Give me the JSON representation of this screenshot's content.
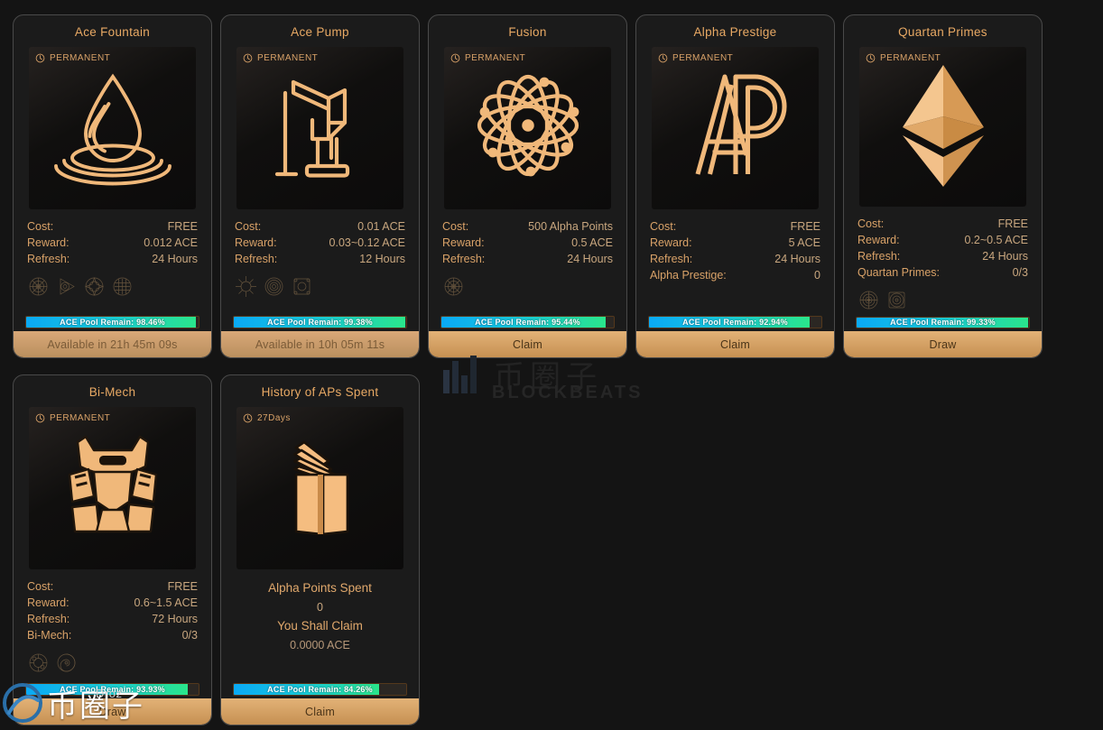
{
  "theme": {
    "page_bg": "#141414",
    "card_bg": "#1b1b1b",
    "card_border": "#4a4a4a",
    "accent": "#e8a964",
    "value_text": "#c9a77f",
    "button_gold": "#e3b277",
    "bar_start": "#0aa9f5",
    "bar_end": "#2ae68b"
  },
  "labels": {
    "cost": "Cost:",
    "reward": "Reward:",
    "refresh": "Refresh:",
    "pool_prefix": "ACE Pool Remain:"
  },
  "cards": [
    {
      "title": "Ace Fountain",
      "badge": "PERMANENT",
      "badge_icon": "clock-icon",
      "art_icon": "water-drop-ripple-icon",
      "stats": [
        {
          "label": "Cost:",
          "value": "FREE"
        },
        {
          "label": "Reward:",
          "value": "0.012 ACE"
        },
        {
          "label": "Refresh:",
          "value": "24 Hours"
        }
      ],
      "emblems": [
        "emblem-gear-icon",
        "emblem-triangle-icon",
        "emblem-star-icon",
        "emblem-grid-icon"
      ],
      "pool_percent": 98.46,
      "pool_text": "ACE Pool Remain: 98.46%",
      "action_label": "Available in 21h 45m 09s",
      "action_state": "waiting"
    },
    {
      "title": "Ace Pump",
      "badge": "PERMANENT",
      "badge_icon": "clock-icon",
      "art_icon": "hand-water-pump-icon",
      "stats": [
        {
          "label": "Cost:",
          "value": "0.01 ACE"
        },
        {
          "label": "Reward:",
          "value": "0.03~0.12 ACE"
        },
        {
          "label": "Refresh:",
          "value": "12 Hours"
        }
      ],
      "emblems": [
        "emblem-burst-icon",
        "emblem-spiral-icon",
        "emblem-square-icon"
      ],
      "pool_percent": 99.38,
      "pool_text": "ACE Pool Remain: 99.38%",
      "action_label": "Available in 10h 05m 11s",
      "action_state": "waiting"
    },
    {
      "title": "Fusion",
      "badge": "PERMANENT",
      "badge_icon": "clock-icon",
      "art_icon": "atom-icon",
      "stats": [
        {
          "label": "Cost:",
          "value": "500 Alpha Points"
        },
        {
          "label": "Reward:",
          "value": "0.5 ACE"
        },
        {
          "label": "Refresh:",
          "value": "24 Hours"
        }
      ],
      "emblems": [
        "emblem-gear-icon"
      ],
      "pool_percent": 95.44,
      "pool_text": "ACE Pool Remain: 95.44%",
      "action_label": "Claim",
      "action_state": "enabled"
    },
    {
      "title": "Alpha Prestige",
      "badge": "PERMANENT",
      "badge_icon": "clock-icon",
      "art_icon": "ap-monogram-icon",
      "stats": [
        {
          "label": "Cost:",
          "value": "FREE"
        },
        {
          "label": "Reward:",
          "value": "5 ACE"
        },
        {
          "label": "Refresh:",
          "value": "24 Hours"
        },
        {
          "label": "Alpha Prestige:",
          "value": "0"
        }
      ],
      "emblems": [],
      "pool_percent": 92.94,
      "pool_text": "ACE Pool Remain: 92.94%",
      "action_label": "Claim",
      "action_state": "enabled"
    },
    {
      "title": "Quartan Primes",
      "badge": "PERMANENT",
      "badge_icon": "clock-icon",
      "art_icon": "ethereum-diamond-icon",
      "stats": [
        {
          "label": "Cost:",
          "value": "FREE"
        },
        {
          "label": "Reward:",
          "value": "0.2~0.5 ACE"
        },
        {
          "label": "Refresh:",
          "value": "24 Hours"
        },
        {
          "label": "Quartan Primes:",
          "value": "0/3"
        }
      ],
      "emblems": [
        "emblem-radial-icon",
        "emblem-target-icon"
      ],
      "pool_percent": 99.33,
      "pool_text": "ACE Pool Remain: 99.33%",
      "action_label": "Draw",
      "action_state": "enabled"
    },
    {
      "title": "Bi-Mech",
      "badge": "PERMANENT",
      "badge_icon": "clock-icon",
      "art_icon": "mech-armor-icon",
      "stats": [
        {
          "label": "Cost:",
          "value": "FREE"
        },
        {
          "label": "Reward:",
          "value": "0.6~1.5 ACE"
        },
        {
          "label": "Refresh:",
          "value": "72 Hours"
        },
        {
          "label": "Bi-Mech:",
          "value": "0/3"
        }
      ],
      "emblems": [
        "emblem-circuit-icon",
        "emblem-shell-icon"
      ],
      "pool_percent": 93.93,
      "pool_text": "ACE Pool Remain: 93.93%",
      "action_label": "Draw",
      "action_state": "enabled"
    }
  ],
  "history_card": {
    "title": "History of APs Spent",
    "badge": "27Days",
    "badge_icon": "clock-icon",
    "art_icon": "open-book-icon",
    "spent_label": "Alpha Points Spent",
    "spent_value": "0",
    "claim_label": "You Shall Claim",
    "claim_value": "0.0000  ACE",
    "pool_percent": 84.26,
    "pool_text": "ACE Pool Remain: 84.26%",
    "action_label": "Claim",
    "action_state": "enabled"
  },
  "watermarks": {
    "center_cn": "币圈子",
    "center_en": "BLOCKBEATS",
    "bottom_left_cn": "币圈子",
    "bottom_left_sub": "Droz"
  }
}
